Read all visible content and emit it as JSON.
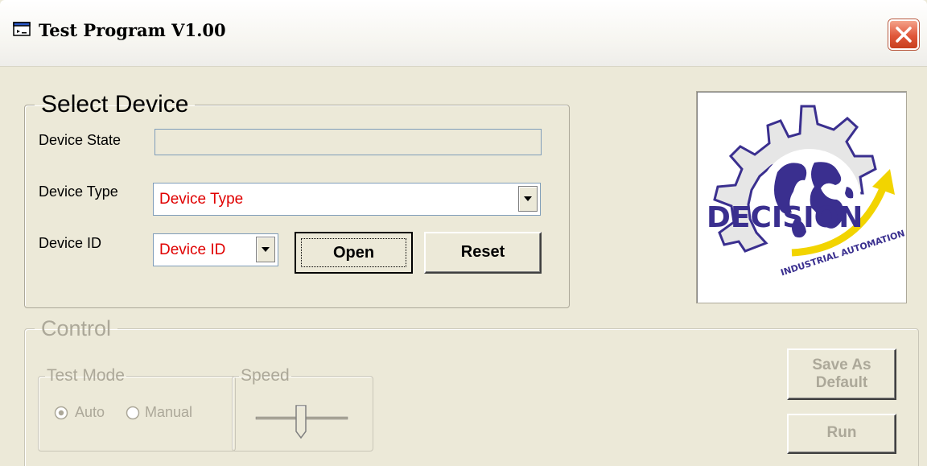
{
  "window": {
    "title": "Test Program V1.00",
    "icon": "app-window-icon"
  },
  "select_device": {
    "legend": "Select Device",
    "device_state_label": "Device State",
    "device_state_value": "",
    "device_type_label": "Device Type",
    "device_type_value": "Device Type",
    "device_id_label": "Device ID",
    "device_id_value": "Device ID",
    "open_label": "Open",
    "reset_label": "Reset"
  },
  "logo": {
    "brand_text": "DECISION",
    "tagline": "INDUSTRIAL AUTOMATION",
    "gear_color": "#dcdcdc",
    "text_color": "#3a2f8f",
    "arrow_color": "#f2d400"
  },
  "control": {
    "legend": "Control",
    "test_mode_legend": "Test Mode",
    "auto_label": "Auto",
    "manual_label": "Manual",
    "selected_mode": "Auto",
    "speed_legend": "Speed",
    "save_default_line1": "Save As",
    "save_default_line2": "Default",
    "run_label": "Run",
    "disabled": true
  },
  "colors": {
    "window_bg": "#ece9d8",
    "combo_text": "#e00000",
    "disabled_text": "#aca899",
    "close_button": "#e0573a"
  }
}
